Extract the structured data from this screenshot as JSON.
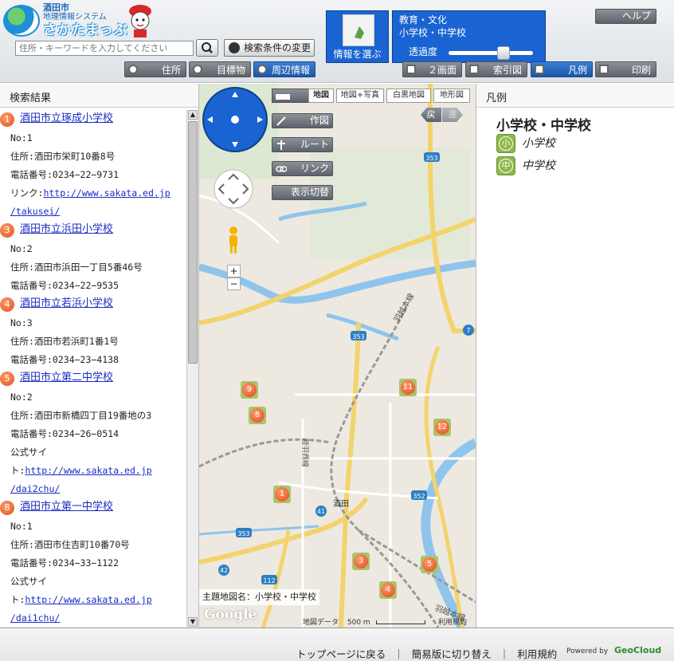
{
  "header": {
    "logo_line1": "酒田市",
    "logo_line2": "地理情報システム",
    "logo_line3": "さかたまっぷ",
    "search_placeholder": "住所・キーワードを入力してください",
    "condition_button": "検索条件の変更",
    "tab_address": "住所",
    "tab_landmark": "目標物",
    "tab_nearby": "周辺情報",
    "info_select": "情報を選ぶ",
    "theme_category": "教育・文化",
    "theme_name": "小学校・中学校",
    "transparency_label": "透過度",
    "transparency_level": 0.65,
    "help": "ヘルプ",
    "btn_split": "２画面",
    "btn_index": "索引図",
    "btn_legend": "凡例",
    "btn_print": "印刷"
  },
  "results": {
    "title": "検索結果",
    "items": [
      {
        "badge": "1",
        "name": "酒田市立琢成小学校",
        "no": "No:1",
        "address": "住所:酒田市栄町10番8号",
        "phone": "電話番号:0234−22−9731",
        "link_label": "リンク:",
        "link1": "http://www.sakata.ed.jp",
        "link2": "/takusei/"
      },
      {
        "badge": "3",
        "name": "酒田市立浜田小学校",
        "no": "No:2",
        "address": "住所:酒田市浜田一丁目5番46号",
        "phone": "電話番号:0234−22−9535"
      },
      {
        "badge": "4",
        "name": "酒田市立若浜小学校",
        "no": "No:3",
        "address": "住所:酒田市若浜町1番1号",
        "phone": "電話番号:0234−23−4138"
      },
      {
        "badge": "5",
        "name": "酒田市立第二中学校",
        "no": "No:2",
        "address": "住所:酒田市新橋四丁目19番地の3",
        "phone": "電話番号:0234−26−0514",
        "link_label1": "公式サイ",
        "link_label2": "ト:",
        "link1": "http://www.sakata.ed.jp",
        "link2": "/dai2chu/"
      },
      {
        "badge": "8",
        "name": "酒田市立第一中学校",
        "no": "No:1",
        "address": "住所:酒田市住吉町10番70号",
        "phone": "電話番号:0234−33−1122",
        "link_label1": "公式サイ",
        "link_label2": "ト:",
        "link1": "http://www.sakata.ed.jp",
        "link2": "/dai1chu/"
      }
    ]
  },
  "map": {
    "tabs": [
      "地図",
      "地図+写真",
      "白黒地図",
      "地形図"
    ],
    "tool_draw": "作図",
    "tool_route": "ルート",
    "tool_link": "リンク",
    "tool_toggle": "表示切替",
    "back": "戻",
    "forward": "進",
    "zoom_in": "+",
    "zoom_out": "−",
    "road_353a": "353",
    "road_353b": "353",
    "road_353c": "353",
    "road_7": "7",
    "road_41": "41",
    "road_42": "42",
    "road_112": "112",
    "road_352": "352",
    "rail_label1": "羽越本線",
    "rail_label2": "羽越本線",
    "rail_label3": "陸羽西線",
    "station": "酒田",
    "markers": [
      "9",
      "11",
      "8",
      "12",
      "1",
      "3",
      "5",
      "4"
    ],
    "caption": "主題地図名：小学校・中学校",
    "data_label": "地図データ",
    "scale": "500 m",
    "terms": "利用規約",
    "google": "Google"
  },
  "legend": {
    "title": "凡例",
    "heading": "小学校・中学校",
    "items": [
      {
        "icon": "小",
        "label": "小学校"
      },
      {
        "icon": "中",
        "label": "中学校"
      }
    ]
  },
  "footer": {
    "top": "トップページに戻る",
    "sep": "｜",
    "simple": "簡易版に切り替え",
    "terms": "利用規約",
    "powered": "Powered by",
    "brand": "GeoCloud"
  }
}
